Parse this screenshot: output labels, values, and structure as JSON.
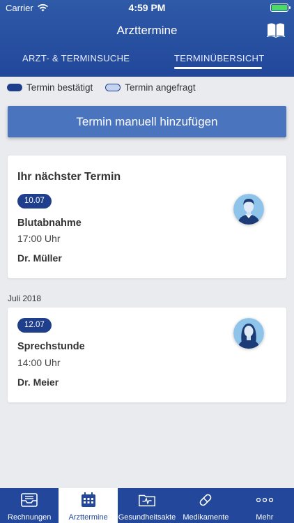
{
  "status": {
    "carrier": "Carrier",
    "time": "4:59 PM"
  },
  "header": {
    "title": "Arzttermine"
  },
  "tabs": [
    {
      "label": "ARZT- & TERMINSUCHE",
      "active": false
    },
    {
      "label": "TERMINÜBERSICHT",
      "active": true
    }
  ],
  "legend": {
    "confirmed": "Termin bestätigt",
    "requested": "Termin angefragt"
  },
  "add_button": "Termin manuell hinzufügen",
  "next": {
    "heading": "Ihr nächster Termin",
    "date": "10.07",
    "name": "Blutabnahme",
    "time": "17:00 Uhr",
    "doctor": "Dr. Müller"
  },
  "month": "Juli 2018",
  "appointment": {
    "date": "12.07",
    "name": "Sprechstunde",
    "time": "14:00 Uhr",
    "doctor": "Dr. Meier"
  },
  "tabbar": [
    {
      "label": "Rechnungen",
      "icon": "inbox-icon",
      "active": false
    },
    {
      "label": "Arzttermine",
      "icon": "calendar-icon",
      "active": true
    },
    {
      "label": "Gesundheitsakte",
      "icon": "health-folder-icon",
      "active": false
    },
    {
      "label": "Medikamente",
      "icon": "pill-icon",
      "active": false
    },
    {
      "label": "Mehr",
      "icon": "more-icon",
      "active": false
    }
  ],
  "colors": {
    "header": "#22479a",
    "accent": "#4b74bf",
    "badge": "#1f3f8c",
    "background": "#e9ebef"
  }
}
